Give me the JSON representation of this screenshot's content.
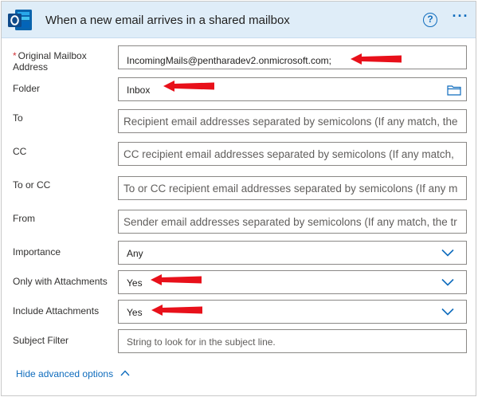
{
  "header": {
    "title": "When a new email arrives in a shared mailbox",
    "help_label": "?",
    "more_label": "···"
  },
  "fields": {
    "original_mailbox": {
      "label_line1": "Original Mailbox",
      "label_line2": "Address",
      "required_mark": "*",
      "value": "IncomingMails@pentharadev2.onmicrosoft.com;"
    },
    "folder": {
      "label": "Folder",
      "value": "Inbox"
    },
    "to": {
      "label": "To",
      "placeholder": "Recipient email addresses separated by semicolons (If any match, the"
    },
    "cc": {
      "label": "CC",
      "placeholder": "CC recipient email addresses separated by semicolons (If any match,"
    },
    "to_or_cc": {
      "label": "To or CC",
      "placeholder": "To or CC recipient email addresses separated by semicolons (If any m"
    },
    "from": {
      "label": "From",
      "placeholder": "Sender email addresses separated by semicolons (If any match, the tr"
    },
    "importance": {
      "label": "Importance",
      "value": "Any"
    },
    "only_with_attachments": {
      "label": "Only with Attachments",
      "value": "Yes"
    },
    "include_attachments": {
      "label": "Include Attachments",
      "value": "Yes"
    },
    "subject_filter": {
      "label": "Subject Filter",
      "placeholder": "String to look for in the subject line."
    }
  },
  "footer": {
    "hide_advanced_label": "Hide advanced options"
  },
  "colors": {
    "accent": "#0f6cbd",
    "header_bg": "#dfedf8",
    "arrow_red": "#e8101a",
    "required": "#d13438"
  }
}
